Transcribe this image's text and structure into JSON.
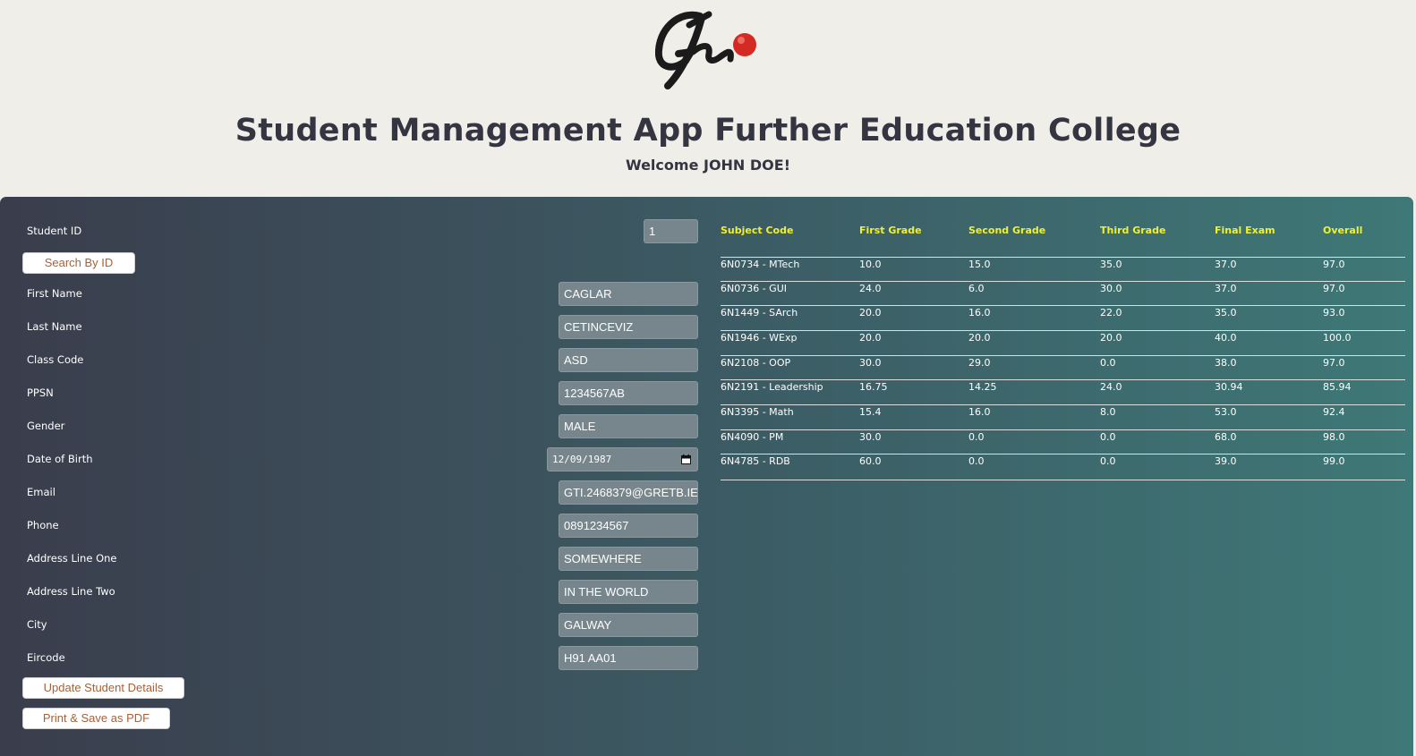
{
  "header": {
    "title": "Student Management App Further Education College",
    "welcome": "Welcome JOHN DOE!",
    "logo_text": "Gti"
  },
  "colors": {
    "background": "#efeee9",
    "panel_gradient_start": "#3a3d4c",
    "panel_gradient_end": "#3e7877",
    "table_header": "#f1f12b",
    "button_text": "#a3623a",
    "logo_dot": "#d42a24"
  },
  "form": {
    "student_id_label": "Student ID",
    "student_id_value": "1",
    "search_button": "Search By ID",
    "fields": [
      {
        "label": "First Name",
        "value": "CAGLAR"
      },
      {
        "label": "Last Name",
        "value": "CETINCEVIZ"
      },
      {
        "label": "Class Code",
        "value": "ASD"
      },
      {
        "label": "PPSN",
        "value": "1234567AB"
      },
      {
        "label": "Gender",
        "value": "MALE"
      },
      {
        "label": "Date of Birth",
        "value": "12/09/1987"
      },
      {
        "label": "Email",
        "value": "GTI.2468379@GRETB.IE"
      },
      {
        "label": "Phone",
        "value": "0891234567"
      },
      {
        "label": "Address Line One",
        "value": "SOMEWHERE"
      },
      {
        "label": "Address Line Two",
        "value": "IN THE WORLD"
      },
      {
        "label": "City",
        "value": "GALWAY"
      },
      {
        "label": "Eircode",
        "value": "H91 AA01"
      }
    ],
    "update_button": "Update Student Details",
    "print_button": "Print & Save as PDF"
  },
  "grades": {
    "columns": [
      "Subject Code",
      "First Grade",
      "Second Grade",
      "Third Grade",
      "Final Exam",
      "Overall"
    ],
    "rows": [
      [
        "6N0734 - MTech",
        "10.0",
        "15.0",
        "35.0",
        "37.0",
        "97.0"
      ],
      [
        "6N0736 - GUI",
        "24.0",
        "6.0",
        "30.0",
        "37.0",
        "97.0"
      ],
      [
        "6N1449 - SArch",
        "20.0",
        "16.0",
        "22.0",
        "35.0",
        "93.0"
      ],
      [
        "6N1946 - WExp",
        "20.0",
        "20.0",
        "20.0",
        "40.0",
        "100.0"
      ],
      [
        "6N2108 - OOP",
        "30.0",
        "29.0",
        "0.0",
        "38.0",
        "97.0"
      ],
      [
        "6N2191 - Leadership",
        "16.75",
        "14.25",
        "24.0",
        "30.94",
        "85.94"
      ],
      [
        "6N3395 - Math",
        "15.4",
        "16.0",
        "8.0",
        "53.0",
        "92.4"
      ],
      [
        "6N4090 - PM",
        "30.0",
        "0.0",
        "0.0",
        "68.0",
        "98.0"
      ],
      [
        "6N4785 - RDB",
        "60.0",
        "0.0",
        "0.0",
        "39.0",
        "99.0"
      ]
    ]
  }
}
